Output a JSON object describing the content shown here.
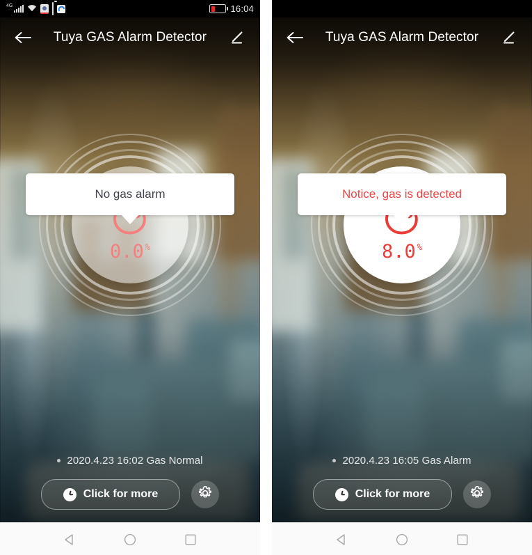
{
  "phones": [
    {
      "id": "left",
      "statusbar": {
        "visible": true,
        "network_label": "4G",
        "icons": [
          "signal-bars-icon",
          "wifi-icon",
          "app-alert-icon",
          "battery-small-icon",
          "app-cloud-icon"
        ],
        "battery_icon": "battery-low-icon",
        "time": "16:04"
      },
      "appbar": {
        "back_icon": "back-arrow-icon",
        "title": "Tuya GAS Alarm Detector",
        "edit_icon": "pencil-edit-icon"
      },
      "alert": {
        "message": "No gas alarm",
        "color": "#40444a",
        "state": "normal"
      },
      "gauge": {
        "flame_icon": "flame-icon",
        "value": "0.0",
        "unit": "%",
        "color": "#f3807f"
      },
      "status_line": {
        "bullet": "status-dot",
        "text": "2020.4.23 16:02 Gas Normal"
      },
      "footer": {
        "more_button_label": "Click for more",
        "clock_icon": "clock-icon",
        "settings_icon": "gear-icon"
      },
      "navbar": {
        "back": "nav-back-icon",
        "home": "nav-home-icon",
        "recents": "nav-recents-icon"
      }
    },
    {
      "id": "right",
      "statusbar": {
        "visible": false,
        "network_label": "",
        "icons": [],
        "battery_icon": "",
        "time": ""
      },
      "appbar": {
        "back_icon": "back-arrow-icon",
        "title": "Tuya GAS Alarm Detector",
        "edit_icon": "pencil-edit-icon"
      },
      "alert": {
        "message": "Notice, gas is detected",
        "color": "#ea4744",
        "state": "alarm"
      },
      "gauge": {
        "flame_icon": "flame-icon",
        "value": "8.0",
        "unit": "%",
        "color": "#ea3c38"
      },
      "status_line": {
        "bullet": "status-dot",
        "text": "2020.4.23 16:05 Gas Alarm"
      },
      "footer": {
        "more_button_label": "Click for more",
        "clock_icon": "clock-icon",
        "settings_icon": "gear-icon"
      },
      "navbar": {
        "back": "nav-back-icon",
        "home": "nav-home-icon",
        "recents": "nav-recents-icon"
      }
    }
  ],
  "colors": {
    "alarm_red": "#ea3c38",
    "normal_pink": "#f3807f",
    "bubble_bg": "#ffffff",
    "statusbar_bg": "#000000",
    "navbar_bg": "#fafafa"
  }
}
